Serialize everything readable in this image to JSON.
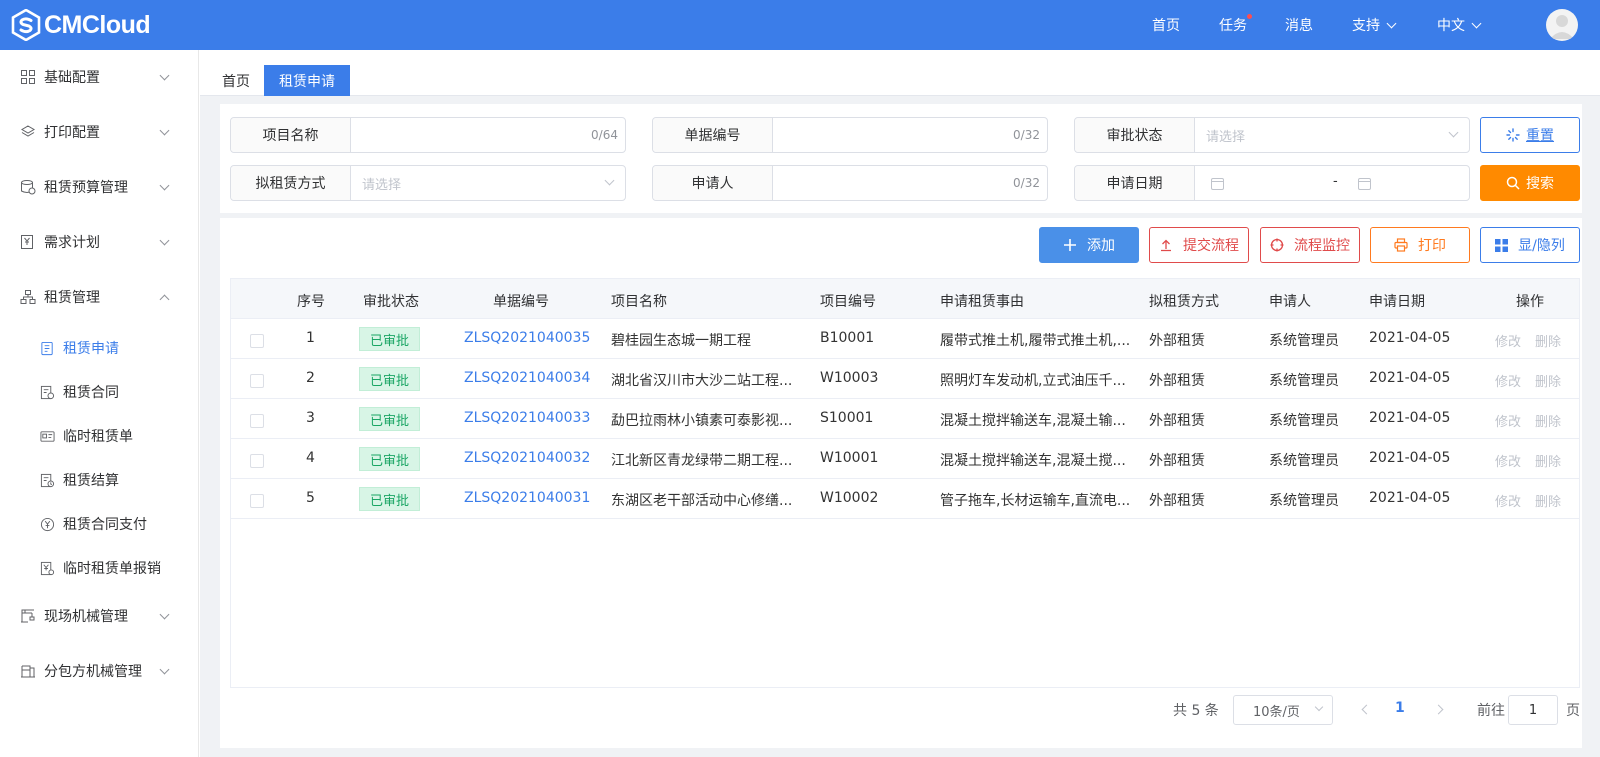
{
  "header": {
    "logo_text": "CMCloud",
    "nav": [
      {
        "label": "首页"
      },
      {
        "label": "任务"
      },
      {
        "label": "消息"
      },
      {
        "label": "支持"
      },
      {
        "label": "中文"
      }
    ]
  },
  "sidebar": {
    "items": [
      {
        "label": "基础配置"
      },
      {
        "label": "打印配置"
      },
      {
        "label": "租赁预算管理"
      },
      {
        "label": "需求计划"
      },
      {
        "label": "租赁管理"
      },
      {
        "label": "现场机械管理"
      },
      {
        "label": "分包方机械管理"
      }
    ],
    "sub_items": [
      {
        "label": "租赁申请"
      },
      {
        "label": "租赁合同"
      },
      {
        "label": "临时租赁单"
      },
      {
        "label": "租赁结算"
      },
      {
        "label": "租赁合同支付"
      },
      {
        "label": "临时租赁单报销"
      }
    ]
  },
  "tabs": [
    {
      "label": "首页"
    },
    {
      "label": "租赁申请"
    }
  ],
  "filters": {
    "project_name": {
      "label": "项目名称",
      "count": "0/64"
    },
    "doc_no": {
      "label": "单据编号",
      "count": "0/32"
    },
    "approval_status": {
      "label": "审批状态",
      "placeholder": "请选择"
    },
    "lease_mode": {
      "label": "拟租赁方式",
      "placeholder": "请选择"
    },
    "applicant": {
      "label": "申请人",
      "count": "0/32"
    },
    "apply_date": {
      "label": "申请日期",
      "separator": "-"
    }
  },
  "buttons": {
    "reset": "重置",
    "search": "搜索",
    "add": "添加",
    "submit_flow": "提交流程",
    "monitor_flow": "流程监控",
    "print": "打印",
    "toggle_cols": "显/隐列"
  },
  "table": {
    "columns": [
      "序号",
      "审批状态",
      "单据编号",
      "项目名称",
      "项目编号",
      "申请租赁事由",
      "拟租赁方式",
      "申请人",
      "申请日期",
      "操作"
    ],
    "rows": [
      {
        "no": "1",
        "status": "已审批",
        "doc": "ZLSQ2021040035",
        "project": "碧桂园生态城一期工程",
        "code": "B10001",
        "reason": "履带式推土机,履带式推土机,...",
        "mode": "外部租赁",
        "applicant": "系统管理员",
        "date": "2021-04-05",
        "edit": "修改",
        "del": "删除"
      },
      {
        "no": "2",
        "status": "已审批",
        "doc": "ZLSQ2021040034",
        "project": "湖北省汉川市大沙二站工程...",
        "code": "W10003",
        "reason": "照明灯车发动机,立式油压千...",
        "mode": "外部租赁",
        "applicant": "系统管理员",
        "date": "2021-04-05",
        "edit": "修改",
        "del": "删除"
      },
      {
        "no": "3",
        "status": "已审批",
        "doc": "ZLSQ2021040033",
        "project": "勐巴拉雨林小镇素可泰影视...",
        "code": "S10001",
        "reason": "混凝土搅拌输送车,混凝土输...",
        "mode": "外部租赁",
        "applicant": "系统管理员",
        "date": "2021-04-05",
        "edit": "修改",
        "del": "删除"
      },
      {
        "no": "4",
        "status": "已审批",
        "doc": "ZLSQ2021040032",
        "project": "江北新区青龙绿带二期工程...",
        "code": "W10001",
        "reason": "混凝土搅拌输送车,混凝土搅...",
        "mode": "外部租赁",
        "applicant": "系统管理员",
        "date": "2021-04-05",
        "edit": "修改",
        "del": "删除"
      },
      {
        "no": "5",
        "status": "已审批",
        "doc": "ZLSQ2021040031",
        "project": "东湖区老干部活动中心修缮...",
        "code": "W10002",
        "reason": "管子拖车,长材运输车,直流电...",
        "mode": "外部租赁",
        "applicant": "系统管理员",
        "date": "2021-04-05",
        "edit": "修改",
        "del": "删除"
      }
    ]
  },
  "pagination": {
    "total": "共 5 条",
    "page_size": "10条/页",
    "current": "1",
    "goto_prefix": "前往",
    "goto_value": "1",
    "goto_suffix": "页"
  }
}
